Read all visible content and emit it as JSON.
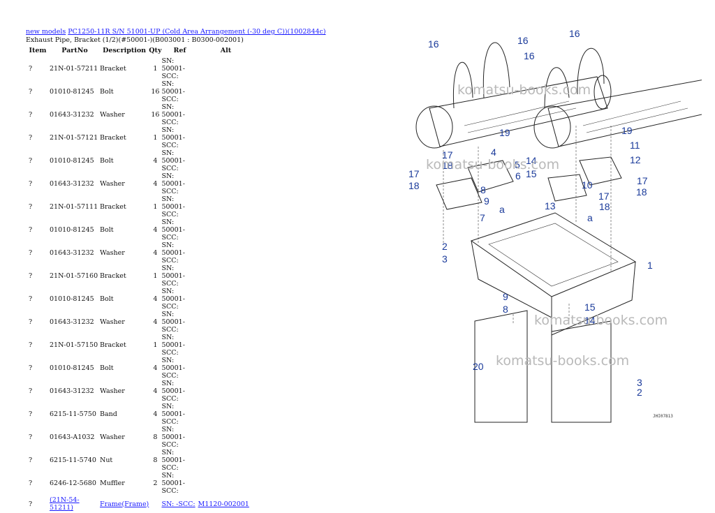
{
  "breadcrumb": {
    "link1": "new models",
    "link2": "PC1250-11R S/N 51001-UP (Cold Area Arrangement (-30 deg C))(1002844c)"
  },
  "subtitle": "Exhaust Pipe, Bracket (1/2)(#50001-)(B003001 : B0300-002001)",
  "table": {
    "headers": [
      "Item",
      "PartNo",
      "Description",
      "Qty",
      "Ref",
      "Alt"
    ],
    "rows": [
      {
        "item": "?",
        "part": "21N-01-57211",
        "desc": "Bracket",
        "qty": "1",
        "ref": "SN: 50001-SCC:",
        "alt": ""
      },
      {
        "item": "?",
        "part": "01010-81245",
        "desc": "Bolt",
        "qty": "16",
        "ref": "SN: 50001-SCC:",
        "alt": ""
      },
      {
        "item": "?",
        "part": "01643-31232",
        "desc": "Washer",
        "qty": "16",
        "ref": "SN: 50001-SCC:",
        "alt": ""
      },
      {
        "item": "?",
        "part": "21N-01-57121",
        "desc": "Bracket",
        "qty": "1",
        "ref": "SN: 50001-SCC:",
        "alt": ""
      },
      {
        "item": "?",
        "part": "01010-81245",
        "desc": "Bolt",
        "qty": "4",
        "ref": "SN: 50001-SCC:",
        "alt": ""
      },
      {
        "item": "?",
        "part": "01643-31232",
        "desc": "Washer",
        "qty": "4",
        "ref": "SN: 50001-SCC:",
        "alt": ""
      },
      {
        "item": "?",
        "part": "21N-01-57111",
        "desc": "Bracket",
        "qty": "1",
        "ref": "SN: 50001-SCC:",
        "alt": ""
      },
      {
        "item": "?",
        "part": "01010-81245",
        "desc": "Bolt",
        "qty": "4",
        "ref": "SN: 50001-SCC:",
        "alt": ""
      },
      {
        "item": "?",
        "part": "01643-31232",
        "desc": "Washer",
        "qty": "4",
        "ref": "SN: 50001-SCC:",
        "alt": ""
      },
      {
        "item": "?",
        "part": "21N-01-57160",
        "desc": "Bracket",
        "qty": "1",
        "ref": "SN: 50001-SCC:",
        "alt": ""
      },
      {
        "item": "?",
        "part": "01010-81245",
        "desc": "Bolt",
        "qty": "4",
        "ref": "SN: 50001-SCC:",
        "alt": ""
      },
      {
        "item": "?",
        "part": "01643-31232",
        "desc": "Washer",
        "qty": "4",
        "ref": "SN: 50001-SCC:",
        "alt": ""
      },
      {
        "item": "?",
        "part": "21N-01-57150",
        "desc": "Bracket",
        "qty": "1",
        "ref": "SN: 50001-SCC:",
        "alt": ""
      },
      {
        "item": "?",
        "part": "01010-81245",
        "desc": "Bolt",
        "qty": "4",
        "ref": "SN: 50001-SCC:",
        "alt": ""
      },
      {
        "item": "?",
        "part": "01643-31232",
        "desc": "Washer",
        "qty": "4",
        "ref": "SN: 50001-SCC:",
        "alt": ""
      },
      {
        "item": "?",
        "part": "6215-11-5750",
        "desc": "Band",
        "qty": "4",
        "ref": "SN: 50001-SCC:",
        "alt": ""
      },
      {
        "item": "?",
        "part": "01643-A1032",
        "desc": "Washer",
        "qty": "8",
        "ref": "SN: 50001-SCC:",
        "alt": ""
      },
      {
        "item": "?",
        "part": "6215-11-5740",
        "desc": "Nut",
        "qty": "8",
        "ref": "SN: 50001-SCC:",
        "alt": ""
      },
      {
        "item": "?",
        "part": "6246-12-5680",
        "desc": "Muffler",
        "qty": "2",
        "ref": "SN: 50001-SCC:",
        "alt": ""
      },
      {
        "item": "?",
        "part": "(21N-54-51211)",
        "desc": "Frame(Frame)",
        "qty": "",
        "ref": "SN: -SCC:",
        "alt": "M1120-002001",
        "linked": true
      }
    ]
  },
  "diagram": {
    "watermark": "komatsu-books.com",
    "drawing_code": "JHI07813",
    "callouts": [
      "16",
      "16",
      "16",
      "16",
      "19",
      "19",
      "4",
      "5",
      "6",
      "17",
      "18",
      "17",
      "18",
      "7",
      "8",
      "9",
      "14",
      "15",
      "11",
      "12",
      "17",
      "18",
      "10",
      "17",
      "18",
      "13",
      "a",
      "a",
      "2",
      "3",
      "1",
      "9",
      "8",
      "15",
      "14",
      "20",
      "3",
      "2"
    ]
  }
}
